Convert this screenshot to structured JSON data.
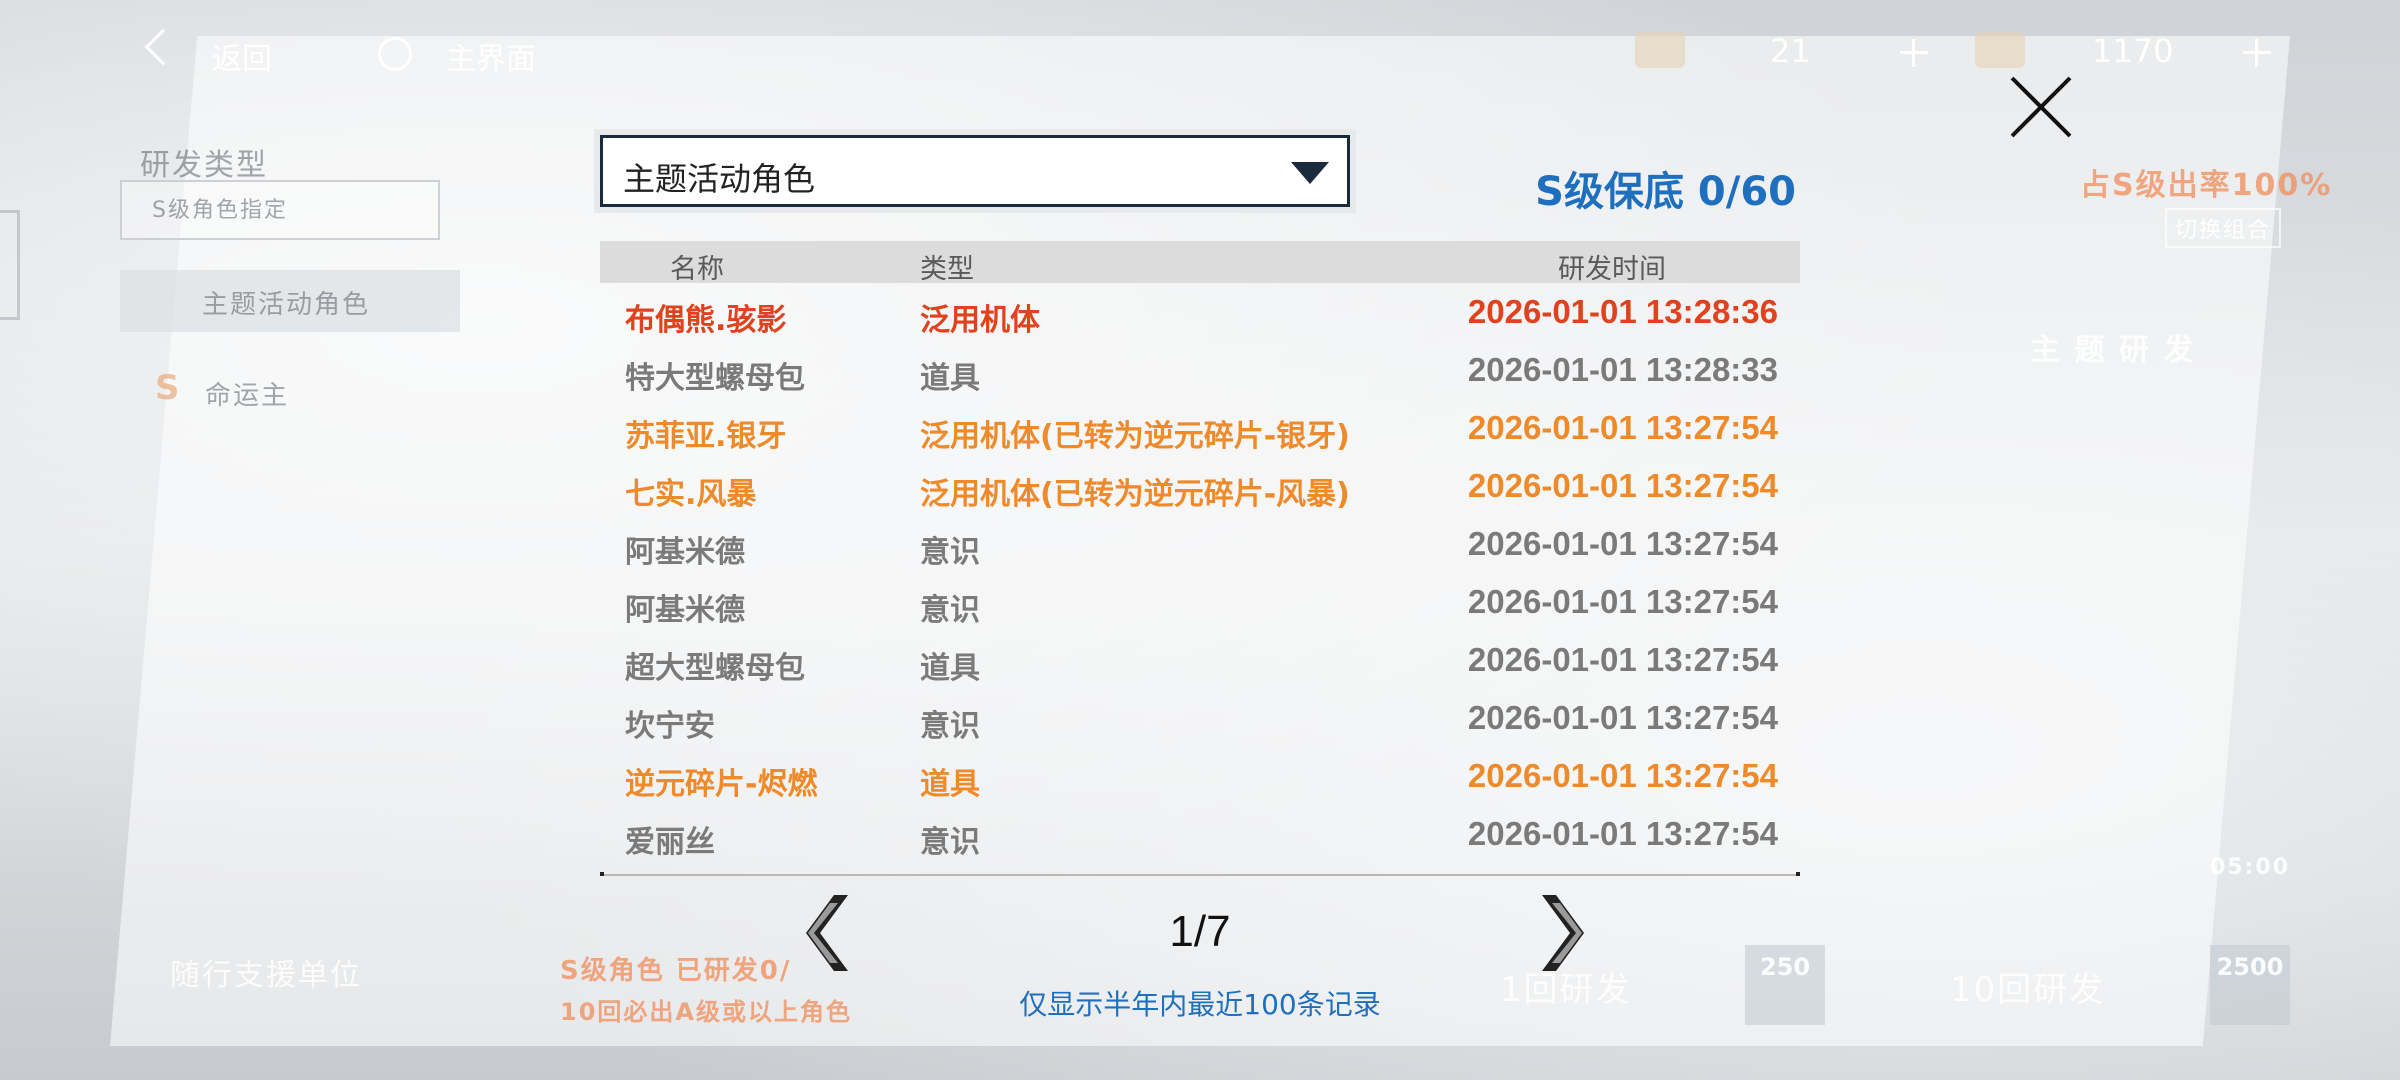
{
  "topbar": {
    "back_label": "返回",
    "home_label": "主界面",
    "resource_1_value": "21",
    "resource_2_value": "1170"
  },
  "background": {
    "research_type_label": "研发类型",
    "left_item_1": "S级角色指定",
    "left_item_2": "主题活动角色",
    "left_item_3": "命运主",
    "theme_research": "主 题 研 发",
    "rate_up": "占S级出率100%",
    "switch_combo": "切换组合",
    "support_unit": "随行支援单位",
    "s_hint": "S级角色 已研发0/",
    "a_hint": "10回必出A级或以上角色",
    "one_pull": "1回研发",
    "one_pull_cost": "250",
    "ten_pull": "10回研发",
    "ten_pull_cost": "2500",
    "timer": "05:00"
  },
  "panel": {
    "dropdown_value": "主题活动角色",
    "pity_text": "S级保底 0/60",
    "columns": {
      "name": "名称",
      "type": "类型",
      "time": "研发时间"
    },
    "records": [
      {
        "name": "布偶熊.骇影",
        "type": "泛用机体",
        "time": "2026-01-01 13:28:36",
        "rarity": "red"
      },
      {
        "name": "特大型螺母包",
        "type": "道具",
        "time": "2026-01-01 13:28:33",
        "rarity": "gray"
      },
      {
        "name": "苏菲亚.银牙",
        "type": "泛用机体(已转为逆元碎片-银牙)",
        "time": "2026-01-01 13:27:54",
        "rarity": "orange"
      },
      {
        "name": "七实.风暴",
        "type": "泛用机体(已转为逆元碎片-风暴)",
        "time": "2026-01-01 13:27:54",
        "rarity": "orange"
      },
      {
        "name": "阿基米德",
        "type": "意识",
        "time": "2026-01-01 13:27:54",
        "rarity": "gray"
      },
      {
        "name": "阿基米德",
        "type": "意识",
        "time": "2026-01-01 13:27:54",
        "rarity": "gray"
      },
      {
        "name": "超大型螺母包",
        "type": "道具",
        "time": "2026-01-01 13:27:54",
        "rarity": "gray"
      },
      {
        "name": "坎宁安",
        "type": "意识",
        "time": "2026-01-01 13:27:54",
        "rarity": "gray"
      },
      {
        "name": "逆元碎片-烬燃",
        "type": "道具",
        "time": "2026-01-01 13:27:54",
        "rarity": "orange"
      },
      {
        "name": "爱丽丝",
        "type": "意识",
        "time": "2026-01-01 13:27:54",
        "rarity": "gray"
      }
    ],
    "page_indicator": "1/7",
    "note": "仅显示半年内最近100条记录"
  },
  "colors": {
    "accent_blue": "#1f6fbf",
    "rarity_red": "#e0421e",
    "rarity_orange": "#ee8a2a",
    "rarity_gray": "#7a7a7a"
  }
}
